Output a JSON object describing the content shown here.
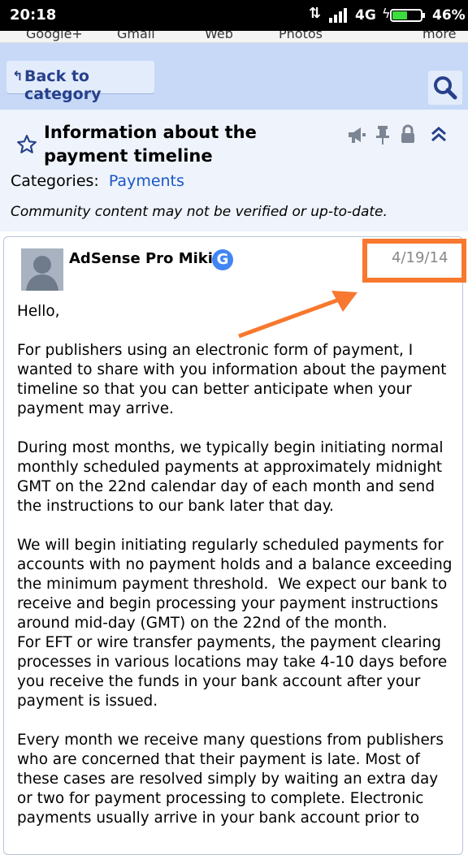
{
  "status_bar": {
    "time": "20:18",
    "network_type": "4G",
    "battery": "46%"
  },
  "google_bar": {
    "items": [
      "Google+",
      "Gmail",
      "Web",
      "Photos",
      "more"
    ]
  },
  "topbar": {
    "back_label": "Back to category"
  },
  "thread": {
    "title": "Information about the payment timeline",
    "categories_label": "Categories:",
    "category_link": "Payments",
    "community_note": "Community content may not be verified or up-to-date."
  },
  "post": {
    "author": "AdSense Pro Miki",
    "badge_letter": "G",
    "date": "4/19/14",
    "paragraphs": [
      "Hello,",
      "For publishers using an electronic form of payment, I wanted to share with you information about the payment timeline so that you can better anticipate when your payment may arrive.",
      "During most months, we typically begin initiating normal monthly scheduled payments at approximately midnight GMT on the 22nd calendar day of each month and send the instructions to our bank later that day.",
      "We will begin initiating regularly scheduled payments for accounts with no payment holds and a balance exceeding the minimum payment threshold.  We expect our bank to receive and begin processing your payment instructions around mid-day (GMT) on the 22nd of the month.\nFor EFT or wire transfer payments, the payment clearing processes in various locations may take 4-10 days before you receive the funds in your bank account after your payment is issued.",
      "Every month we receive many questions from publishers who are concerned that their payment is late. Most of these cases are resolved simply by waiting an extra day or two for payment processing to complete. Electronic payments usually arrive in your bank account prior to"
    ]
  },
  "colors": {
    "accent_orange": "#f7782e",
    "topbar_blue": "#c7d9f7",
    "link_blue": "#1a57c7"
  }
}
